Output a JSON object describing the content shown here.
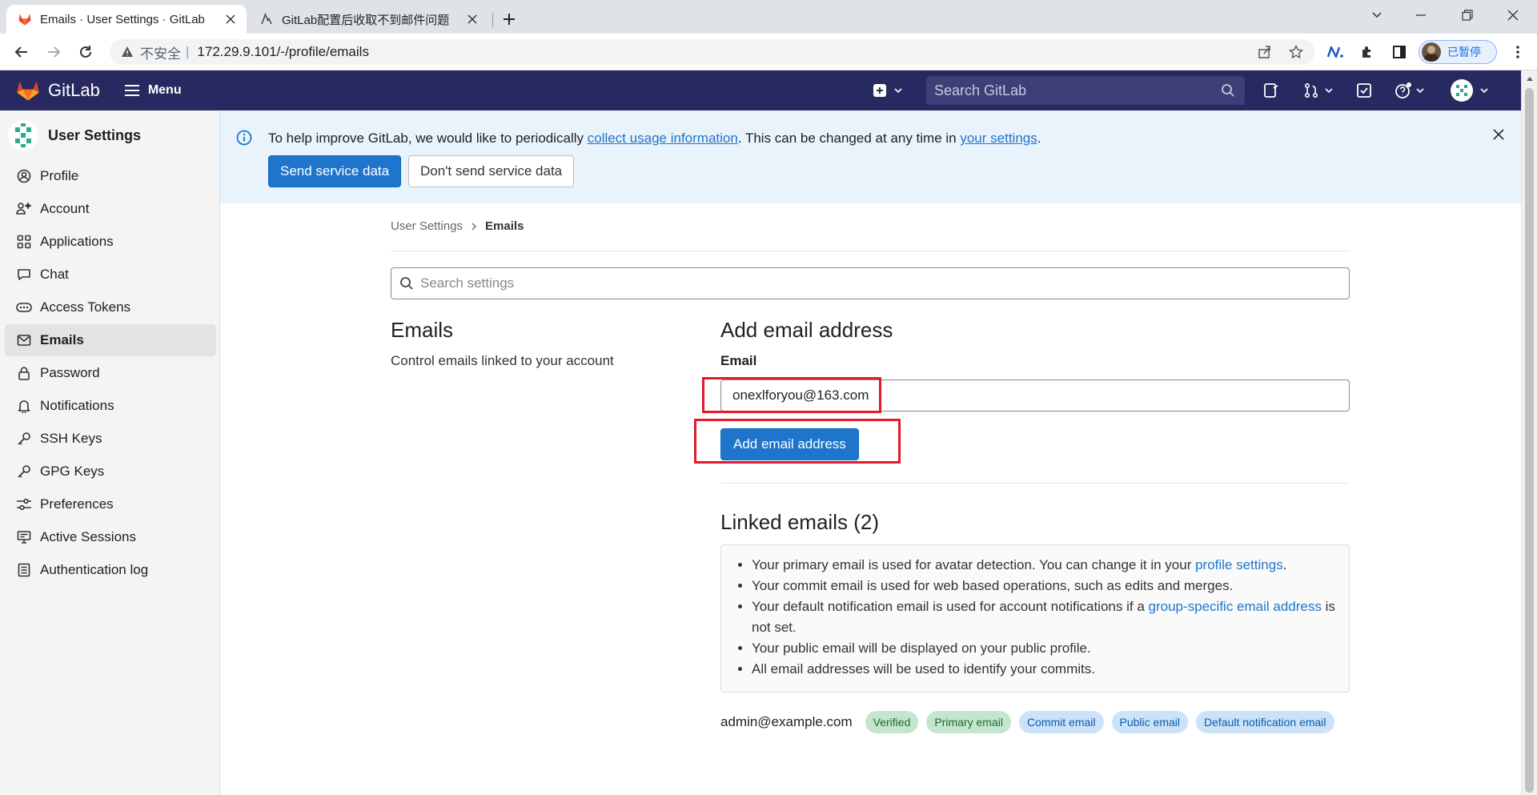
{
  "browser": {
    "tabs": [
      {
        "title": "Emails · User Settings · GitLab",
        "active": true
      },
      {
        "title": "GitLab配置后收取不到邮件问题",
        "active": false
      }
    ],
    "address": {
      "security": "不安全",
      "url": "172.29.9.101/-/profile/emails"
    },
    "profile_status": "已暂停"
  },
  "header": {
    "brand": "GitLab",
    "menu_label": "Menu",
    "search_placeholder": "Search GitLab"
  },
  "sidebar": {
    "context_title": "User Settings",
    "items": [
      {
        "label": "Profile",
        "icon": "profile-icon"
      },
      {
        "label": "Account",
        "icon": "account-icon"
      },
      {
        "label": "Applications",
        "icon": "applications-icon"
      },
      {
        "label": "Chat",
        "icon": "chat-icon"
      },
      {
        "label": "Access Tokens",
        "icon": "token-icon"
      },
      {
        "label": "Emails",
        "icon": "mail-icon",
        "active": true
      },
      {
        "label": "Password",
        "icon": "lock-icon"
      },
      {
        "label": "Notifications",
        "icon": "bell-icon"
      },
      {
        "label": "SSH Keys",
        "icon": "key-icon"
      },
      {
        "label": "GPG Keys",
        "icon": "key-icon"
      },
      {
        "label": "Preferences",
        "icon": "preferences-icon"
      },
      {
        "label": "Active Sessions",
        "icon": "monitor-icon"
      },
      {
        "label": "Authentication log",
        "icon": "log-icon"
      }
    ]
  },
  "banner": {
    "text_before": "To help improve GitLab, we would like to periodically ",
    "link1": "collect usage information",
    "text_middle": ". This can be changed at any time in ",
    "link2": "your settings",
    "text_after": ".",
    "send_button": "Send service data",
    "dont_send_button": "Don't send service data"
  },
  "breadcrumb": {
    "parent": "User Settings",
    "current": "Emails"
  },
  "settings_search_placeholder": "Search settings",
  "emails_section": {
    "title": "Emails",
    "description": "Control emails linked to your account"
  },
  "add_email": {
    "title": "Add email address",
    "label": "Email",
    "value": "onexlforyou@163.com",
    "button": "Add email address"
  },
  "linked": {
    "title": "Linked emails (2)",
    "notes": {
      "n1_text": "Your primary email is used for avatar detection. You can change it in your ",
      "n1_link": "profile settings",
      "n1_end": ".",
      "n2": "Your commit email is used for web based operations, such as edits and merges.",
      "n3_text": "Your default notification email is used for account notifications if a ",
      "n3_link": "group-specific email address",
      "n3_end": " is not set.",
      "n4": "Your public email will be displayed on your public profile.",
      "n5": "All email addresses will be used to identify your commits."
    },
    "entry": {
      "address": "admin@example.com",
      "badges": [
        "Verified",
        "Primary email",
        "Commit email",
        "Public email",
        "Default notification email"
      ]
    }
  },
  "colors": {
    "header_bg": "#292961",
    "primary": "#1f75cb",
    "highlight": "#e21a2a"
  }
}
